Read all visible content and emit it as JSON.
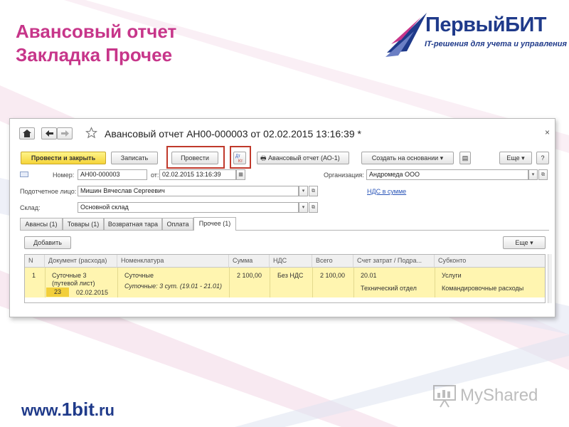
{
  "slide": {
    "title_line1": "Авансовый отчет",
    "title_line2": "Закладка Прочее",
    "logo_name": "ПервыйБИТ",
    "logo_tagline": "IT-решения для учета и управления",
    "footer_url_prefix": "www.",
    "footer_url_big": "1bit",
    "footer_url_suffix": ".ru",
    "watermark": "MyShared",
    "colors": {
      "title": "#c7368a",
      "brand": "#1f3a8a",
      "highlight_row": "#fff5b0",
      "primary_button": "#f5d43a",
      "annotation": "#c0392b"
    }
  },
  "window": {
    "nav": {
      "home_icon": "home-icon",
      "back_icon": "arrow-left-icon",
      "forward_icon": "arrow-right-icon",
      "favorite_icon": "star-icon",
      "close_icon": "close-icon"
    },
    "title": "Авансовый отчет АН00-000003 от 02.02.2015 13:16:39 *",
    "toolbar": {
      "post_close": "Провести и закрыть",
      "save": "Записать",
      "post": "Провести",
      "movements_icon": "dt-kt-icon",
      "print_report": "Авансовый отчет (АО-1)",
      "create_based": "Создать на основании",
      "more": "Еще",
      "help": "?"
    },
    "form": {
      "number_label": "Номер:",
      "number_value": "АН00-000003",
      "date_label": "от:",
      "date_value": "02.02.2015 13:16:39",
      "org_label": "Организация:",
      "org_value": "Андромеда ООО",
      "person_label": "Подотчетное лицо:",
      "person_value": "Мишин Вячеслав Сергеевич",
      "vat_link": "НДС в сумме",
      "warehouse_label": "Склад:",
      "warehouse_value": "Основной склад"
    },
    "tabs": [
      "Авансы (1)",
      "Товары (1)",
      "Возвратная тара",
      "Оплата",
      "Прочее (1)"
    ],
    "active_tab": "Прочее (1)",
    "table_toolbar": {
      "add": "Добавить",
      "more": "Еще"
    },
    "table": {
      "columns": [
        "N",
        "Документ (расхода)",
        "Номенклатура",
        "Сумма",
        "НДС",
        "Всего",
        "Счет затрат / Подра...",
        "Субконто"
      ],
      "rows": [
        {
          "n": "1",
          "document": "Суточные 3",
          "document_note": "(путевой лист)",
          "doc_number": "23",
          "doc_date": "02.02.2015",
          "nomenclature": "Суточные",
          "nomenclature_detail": "Суточные: 3 сут. (19.01 - 21.01)",
          "sum": "2 100,00",
          "vat": "Без НДС",
          "total": "2 100,00",
          "account": "20.01",
          "department": "Технический отдел",
          "subconto1": "Услуги",
          "subconto2": "Командировочные расходы"
        }
      ]
    }
  }
}
